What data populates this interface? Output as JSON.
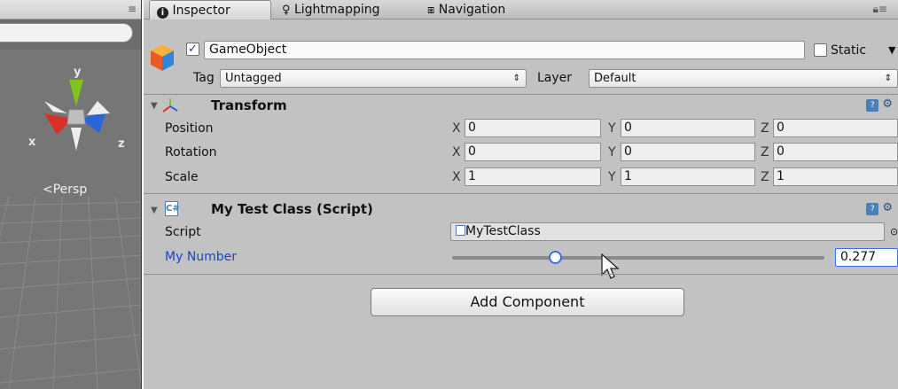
{
  "scene": {
    "axes": {
      "y": "y",
      "x": "x",
      "z": "z"
    },
    "persp_label": "Persp",
    "menu_icon": "≡"
  },
  "tabs": [
    {
      "label": "Inspector",
      "icon": "info-icon"
    },
    {
      "label": "Lightmapping",
      "icon": "bulb-icon"
    },
    {
      "label": "Navigation",
      "icon": "navigation-icon"
    }
  ],
  "gameobject": {
    "active": true,
    "name": "GameObject",
    "static_label": "Static",
    "static_checked": false,
    "tag_label": "Tag",
    "tag_value": "Untagged",
    "layer_label": "Layer",
    "layer_value": "Default"
  },
  "transform": {
    "title": "Transform",
    "rows": [
      {
        "label": "Position",
        "x": "0",
        "y": "0",
        "z": "0"
      },
      {
        "label": "Rotation",
        "x": "0",
        "y": "0",
        "z": "0"
      },
      {
        "label": "Scale",
        "x": "1",
        "y": "1",
        "z": "1"
      }
    ],
    "axis_x": "X",
    "axis_y": "Y",
    "axis_z": "Z"
  },
  "script_component": {
    "title": "My Test Class (Script)",
    "script_label": "Script",
    "script_value": "MyTestClass",
    "number_label": "My Number",
    "number_value": "0.277",
    "slider_fraction": 0.277
  },
  "add_component_label": "Add Component",
  "colors": {
    "panel_bg": "#c2c2c2",
    "label_blue": "#1a46c8",
    "axis_x": "#d63227",
    "axis_y": "#7fc31d",
    "axis_z": "#2a66d8"
  }
}
